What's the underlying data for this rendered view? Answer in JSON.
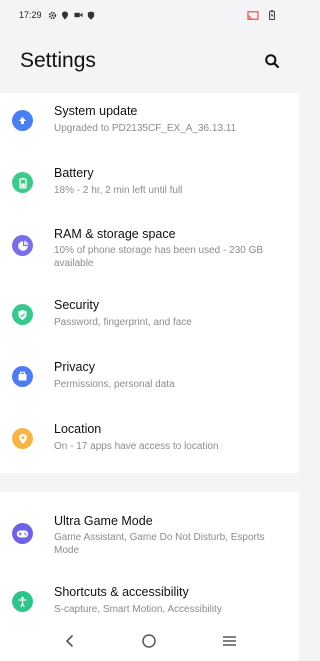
{
  "status_bar": {
    "time": "17:29"
  },
  "header": {
    "title": "Settings"
  },
  "items": [
    {
      "label": "System update",
      "sub": "Upgraded to PD2135CF_EX_A_36.13.11",
      "icon": "upload-icon",
      "color": "#4a7ff0"
    },
    {
      "label": "Battery",
      "sub": "18% - 2 hr, 2 min left until full",
      "icon": "battery-icon",
      "color": "#3fc98a"
    },
    {
      "label": "RAM & storage space",
      "sub": "10% of phone storage has been used - 230 GB available",
      "icon": "pie-chart-icon",
      "color": "#7a6ee8"
    },
    {
      "label": "Security",
      "sub": "Password, fingerprint, and face",
      "icon": "shield-icon",
      "color": "#37c98c"
    },
    {
      "label": "Privacy",
      "sub": "Permissions, personal data",
      "icon": "lock-icon",
      "color": "#4f7df0"
    },
    {
      "label": "Location",
      "sub": "On - 17 apps have access to location",
      "icon": "location-pin-icon",
      "color": "#f5b547"
    },
    {
      "label": "Ultra Game Mode",
      "sub": "Game Assistant, Game Do Not Disturb, Esports Mode",
      "icon": "gamepad-icon",
      "color": "#6c63e6"
    },
    {
      "label": "Shortcuts & accessibility",
      "sub": "S-capture, Smart Motion, Accessibility",
      "icon": "accessibility-icon",
      "color": "#2fc48a"
    }
  ]
}
